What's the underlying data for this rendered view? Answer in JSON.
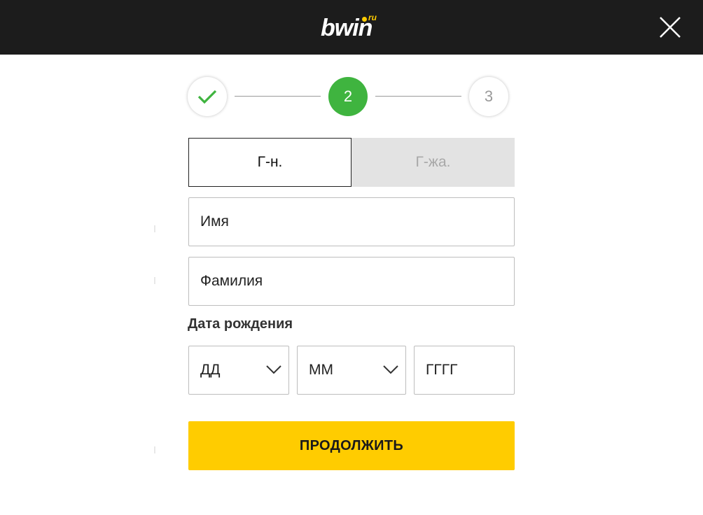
{
  "header": {
    "logo_text": "bwin",
    "logo_suffix": "ru",
    "close_icon": "close-icon",
    "background_color": "#1c1c1c",
    "logo_accent_color": "#ffcc00"
  },
  "stepper": {
    "steps": [
      {
        "label": "",
        "state": "completed",
        "icon": "checkmark-icon"
      },
      {
        "label": "2",
        "state": "active"
      },
      {
        "label": "3",
        "state": "pending"
      }
    ],
    "active_color": "#3fb43f"
  },
  "gender": {
    "male_label": "Г-н.",
    "female_label": "Г-жа.",
    "selected": "male"
  },
  "form": {
    "first_name_placeholder": "Имя",
    "last_name_placeholder": "Фамилия",
    "dob_label": "Дата рождения",
    "dob_day": "ДД",
    "dob_month": "ММ",
    "dob_year": "ГГГГ",
    "dropdown_icon": "chevron-down-icon"
  },
  "actions": {
    "continue_label": "ПРОДОЛЖИТЬ",
    "continue_color": "#ffcc00"
  }
}
